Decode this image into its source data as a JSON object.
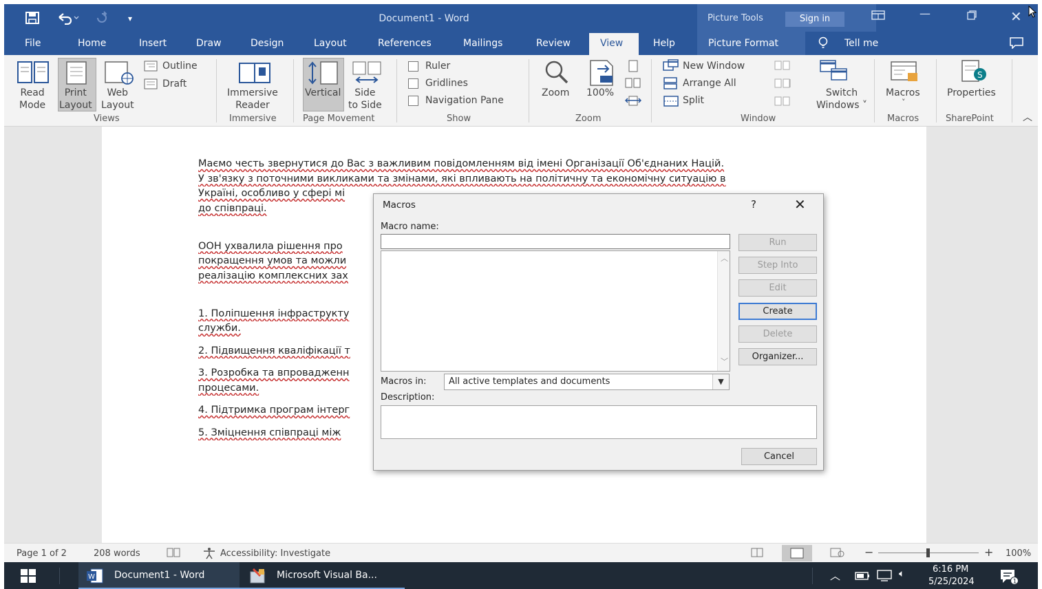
{
  "window": {
    "title": "Document1 - Word",
    "picture_tools": "Picture Tools",
    "sign_in": "Sign in"
  },
  "tabs": [
    "File",
    "Home",
    "Insert",
    "Draw",
    "Design",
    "Layout",
    "References",
    "Mailings",
    "Review",
    "View",
    "Help",
    "Picture Format",
    "Tell me"
  ],
  "active_tab": "View",
  "ribbon": {
    "views": {
      "read_mode": [
        "Read",
        "Mode"
      ],
      "print_layout": [
        "Print",
        "Layout"
      ],
      "web_layout": [
        "Web",
        "Layout"
      ],
      "outline": "Outline",
      "draft": "Draft",
      "group": "Views"
    },
    "immersive": {
      "reader": [
        "Immersive",
        "Reader"
      ],
      "group": "Immersive"
    },
    "page_movement": {
      "vertical": "Vertical",
      "side_to_side": [
        "Side",
        "to Side"
      ],
      "group": "Page Movement"
    },
    "show": {
      "ruler": "Ruler",
      "gridlines": "Gridlines",
      "navigation_pane": "Navigation Pane",
      "group": "Show"
    },
    "zoom": {
      "zoom": "Zoom",
      "hundred": "100%",
      "group": "Zoom"
    },
    "window": {
      "new_window": "New Window",
      "arrange_all": "Arrange All",
      "split": "Split",
      "switch_windows": [
        "Switch",
        "Windows ˅"
      ],
      "group": "Window"
    },
    "macros": {
      "macros": "Macros",
      "group": "Macros"
    },
    "sharepoint": {
      "properties": "Properties",
      "group": "SharePoint"
    }
  },
  "document": {
    "lines": [
      "Маємо честь звернутися до Вас з важливим повідомленням від імені Організації Об'єднаних Націй.",
      "У зв'язку з поточними викликами та змінами, які впливають на політичну та економічну ситуацію в",
      "Україні, особливо у сфері мі",
      "до співпраці.",
      "",
      "ООН ухвалила рішення про",
      "покращення умов та можли",
      "реалізацію комплексних зах",
      "",
      "1. Поліпшення інфраструкту",
      "служби.",
      "2. Підвищення кваліфікації т",
      "3. Розробка та впровадженн",
      "процесами.",
      "4. Підтримка програм інтерг",
      "5. Зміцнення співпраці між"
    ]
  },
  "dialog": {
    "title": "Macros",
    "help": "?",
    "close": "✕",
    "macro_name_label": "Macro name:",
    "macro_name_value": "",
    "macros_in_label": "Macros in:",
    "macros_in_value": "All active templates and documents",
    "description_label": "Description:",
    "buttons": {
      "run": "Run",
      "step_into": "Step Into",
      "edit": "Edit",
      "create": "Create",
      "delete": "Delete",
      "organizer": "Organizer...",
      "cancel": "Cancel"
    }
  },
  "status": {
    "page": "Page 1 of 2",
    "words": "208 words",
    "accessibility": "Accessibility: Investigate",
    "zoom": "100%"
  },
  "taskbar": {
    "word": "Document1 - Word",
    "vba": "Microsoft Visual Ba...",
    "time": "6:16 PM",
    "date": "5/25/2024"
  },
  "colors": {
    "title_bar": "#2b579a",
    "accent": "#3c7ad3",
    "taskbar": "#1f2a36"
  }
}
